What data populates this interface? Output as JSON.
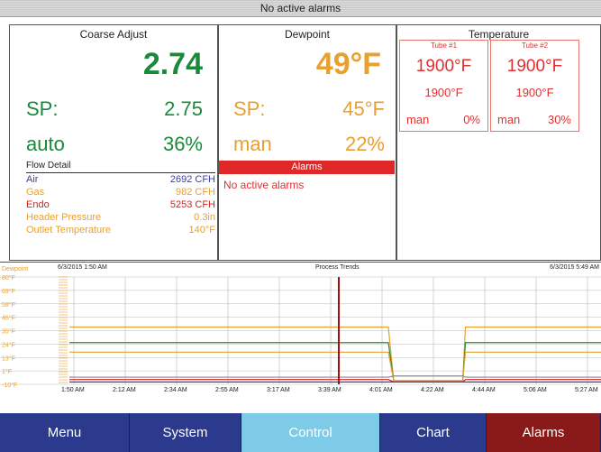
{
  "header": {
    "status": "No active alarms"
  },
  "coarse": {
    "title": "Coarse Adjust",
    "value": "2.74",
    "sp_label": "SP:",
    "sp_value": "2.75",
    "mode": "auto",
    "output": "36%"
  },
  "flow": {
    "title": "Flow Detail",
    "rows": [
      {
        "label": "Air",
        "value": "2692 CFH",
        "color": "#3b3fa8"
      },
      {
        "label": "Gas",
        "value": "982 CFH",
        "color": "#e8a030"
      },
      {
        "label": "Endo",
        "value": "5253 CFH",
        "color": "#d82020"
      },
      {
        "label": "Header Pressure",
        "value": "0.3in",
        "color": "#e8a030"
      },
      {
        "label": "Outlet Temperature",
        "value": "140°F",
        "color": "#e8a030"
      }
    ]
  },
  "dewpoint": {
    "title": "Dewpoint",
    "value": "49°F",
    "sp_label": "SP:",
    "sp_value": "45°F",
    "mode": "man",
    "output": "22%"
  },
  "alarms_panel": {
    "title": "Alarms",
    "message": "No active alarms"
  },
  "temperature": {
    "title": "Temperature",
    "tubes": [
      {
        "name": "Tube #1",
        "pv": "1900°F",
        "sp": "1900°F",
        "mode": "man",
        "output": "0%"
      },
      {
        "name": "Tube #2",
        "pv": "1900°F",
        "sp": "1900°F",
        "mode": "man",
        "output": "30%"
      }
    ]
  },
  "trend": {
    "label_left": "Dewpoint",
    "start_time": "6/3/2015 1:50 AM",
    "title": "Process Trends",
    "end_time": "6/3/2015 5:49 AM"
  },
  "chart_data": {
    "type": "line",
    "title": "Process Trends",
    "x": [
      "1:50 AM",
      "2:12 AM",
      "2:34 AM",
      "2:55 AM",
      "3:17 AM",
      "3:39 AM",
      "4:01 AM",
      "4:22 AM",
      "4:44 AM",
      "5:06 AM",
      "5:27 AM"
    ],
    "yticks": [
      "80°F",
      "69°F",
      "58°F",
      "46°F",
      "35°F",
      "24°F",
      "13°F",
      "1°F",
      "-10°F"
    ],
    "ylim": [
      -10,
      80
    ],
    "cursor_time": "3:55 AM",
    "series": [
      {
        "color": "#e8a030",
        "points": [
          [
            0,
            38
          ],
          [
            0.6,
            38
          ],
          [
            0.61,
            -7
          ],
          [
            0.74,
            -7
          ],
          [
            0.745,
            38
          ],
          [
            1,
            38
          ]
        ]
      },
      {
        "color": "#2a8a3a",
        "points": [
          [
            0,
            25
          ],
          [
            0.6,
            25
          ],
          [
            0.61,
            -7
          ],
          [
            0.74,
            -7
          ],
          [
            0.745,
            25
          ],
          [
            1,
            25
          ]
        ]
      },
      {
        "color": "#e8a030",
        "points": [
          [
            0,
            17
          ],
          [
            0.6,
            17
          ],
          [
            0.61,
            -7
          ],
          [
            0.74,
            -7
          ],
          [
            0.745,
            17
          ],
          [
            1,
            17
          ]
        ]
      },
      {
        "color": "#d82020",
        "points": [
          [
            0,
            -6
          ],
          [
            0.6,
            -6
          ],
          [
            0.61,
            -8
          ],
          [
            0.74,
            -8
          ],
          [
            0.745,
            -6
          ],
          [
            1,
            -6
          ]
        ]
      },
      {
        "color": "#3b3fa8",
        "points": [
          [
            0,
            -8
          ],
          [
            1,
            -8
          ]
        ]
      },
      {
        "color": "#888888",
        "points": [
          [
            0,
            -4
          ],
          [
            0.6,
            -4
          ],
          [
            0.61,
            -3
          ],
          [
            0.74,
            -3
          ],
          [
            0.745,
            -4
          ],
          [
            1,
            -4
          ]
        ]
      }
    ]
  },
  "nav": {
    "items": [
      {
        "label": "Menu",
        "bg": "#2b3a8c"
      },
      {
        "label": "System",
        "bg": "#2b3a8c"
      },
      {
        "label": "Control",
        "bg": "#7ecbe8"
      },
      {
        "label": "Chart",
        "bg": "#2b3a8c"
      },
      {
        "label": "Alarms",
        "bg": "#8a1a1a"
      }
    ]
  }
}
